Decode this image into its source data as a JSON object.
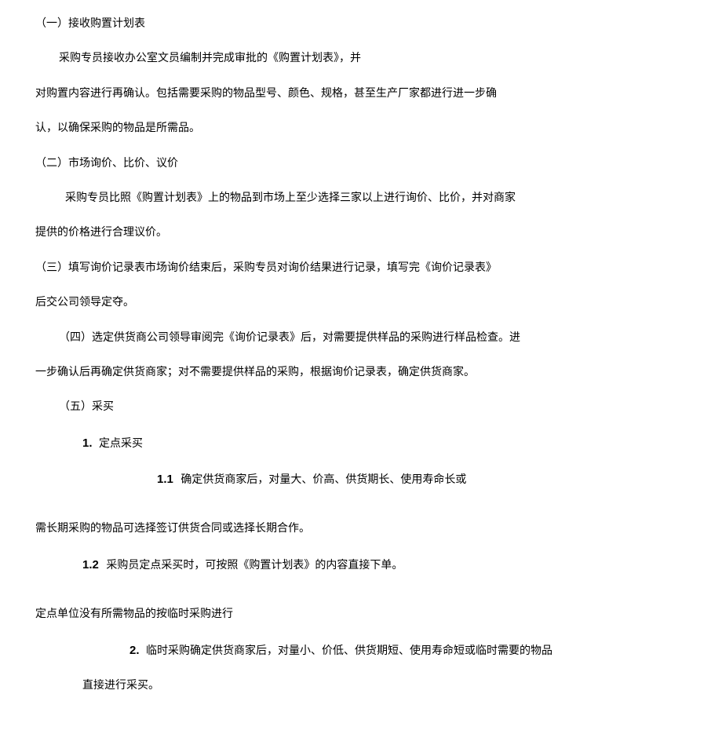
{
  "sections": {
    "s1": {
      "title": "（一）接收购置计划表",
      "p1": "采购专员接收办公室文员编制并完成审批的《购置计划表》，并",
      "p2": "对购置内容进行再确认。包括需要采购的物品型号、颜色、规格，甚至生产厂家都进行进一步确",
      "p3": "认，以确保采购的物品是所需品。"
    },
    "s2": {
      "title": "（二）市场询价、比价、议价",
      "p1": "采购专员比照《购置计划表》上的物品到市场上至少选择三家以上进行询价、比价，并对商家",
      "p2": "提供的价格进行合理议价。"
    },
    "s3": {
      "p1": "（三）填写询价记录表市场询价结束后，采购专员对询价结果进行记录，填写完《询价记录表》",
      "p2": "后交公司领导定夺。"
    },
    "s4": {
      "p1": "（四）选定供货商公司领导审阅完《询价记录表》后，对需要提供样品的采购进行样品检查。进",
      "p2": "一步确认后再确定供货商家；对不需要提供样品的采购，根据询价记录表，确定供货商家。"
    },
    "s5": {
      "title": "（五）采买",
      "item1": {
        "num": "1.",
        "label": "定点采买",
        "sub1": {
          "num": "1.1",
          "text": "确定供货商家后，对量大、价高、供货期长、使用寿命长或"
        },
        "p1": "需长期采购的物品可选择签订供货合同或选择长期合作。",
        "sub2": {
          "num": "1.2",
          "text": "采购员定点采买时，可按照《购置计划表》的内容直接下单。"
        },
        "p2": "定点单位没有所需物品的按临时采购进行"
      },
      "item2": {
        "num": "2.",
        "text": "临时采购确定供货商家后，对量小、价低、供货期短、使用寿命短或临时需要的物品",
        "p1": "直接进行采买。"
      }
    }
  }
}
